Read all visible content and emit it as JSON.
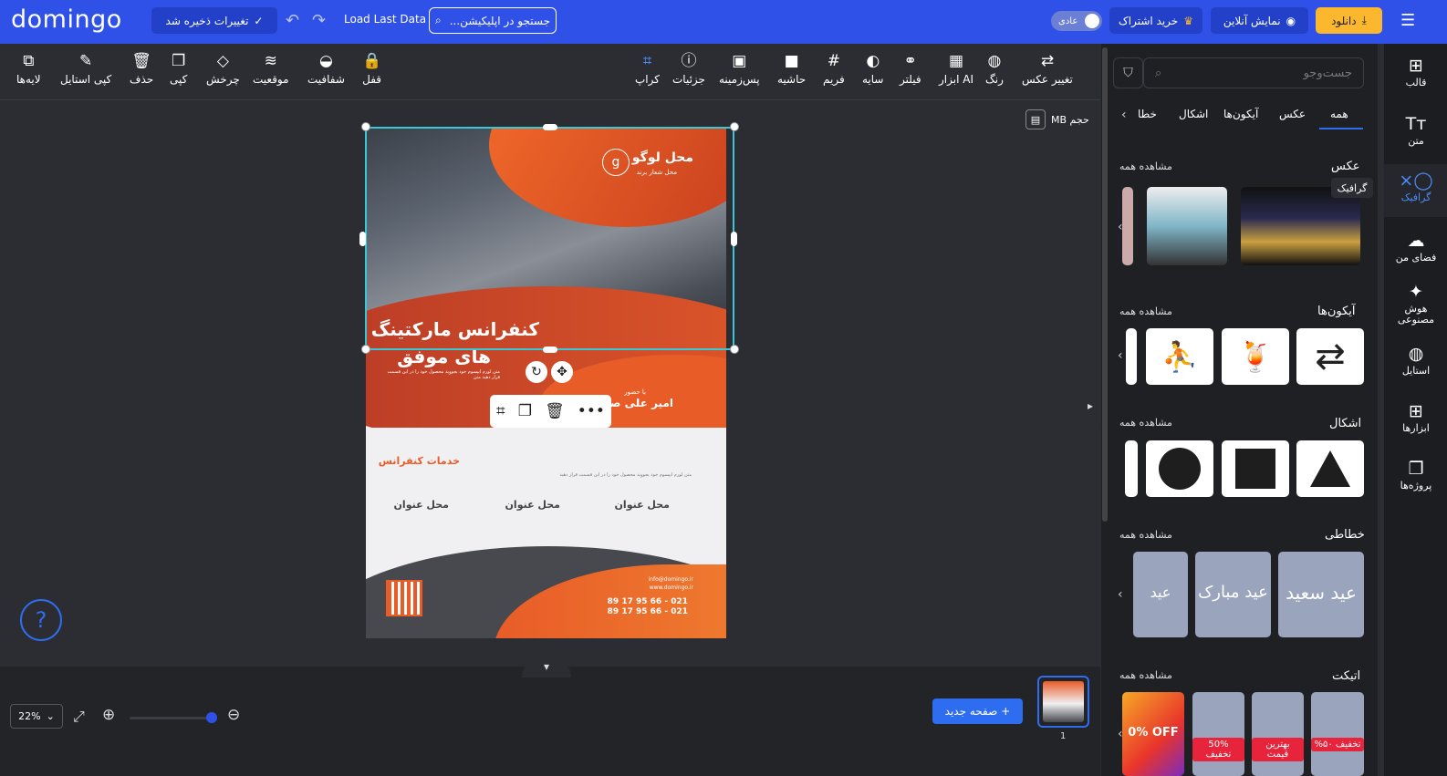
{
  "topbar": {
    "logo": "domingo",
    "save_label": "تغییرات ذخیره شد",
    "load_last": "Load Last Data",
    "search_placeholder": "جستجو در اپلیکیشن...",
    "mode_label": "عادی",
    "subscribe_label": "خرید اشتراک",
    "preview_label": "نمایش آنلاین",
    "download_label": "دانلود"
  },
  "toolbar": {
    "left": [
      {
        "label": "لایه‌ها",
        "icon": "layers-icon"
      },
      {
        "label": "کپی استایل",
        "icon": "brush-icon"
      },
      {
        "label": "حذف",
        "icon": "trash-icon"
      },
      {
        "label": "کپی",
        "icon": "copy-icon"
      },
      {
        "label": "چرخش",
        "icon": "rotate-icon"
      },
      {
        "label": "موقعیت",
        "icon": "position-icon"
      },
      {
        "label": "شفافیت",
        "icon": "opacity-icon"
      },
      {
        "label": "قفل",
        "icon": "lock-icon"
      }
    ],
    "right": [
      {
        "label": "کراپ",
        "icon": "crop-icon"
      },
      {
        "label": "جزئیات",
        "icon": "info-icon"
      },
      {
        "label": "پس‌زمینه",
        "icon": "background-icon"
      },
      {
        "label": "حاشیه",
        "icon": "border-icon"
      },
      {
        "label": "فریم",
        "icon": "frame-icon"
      },
      {
        "label": "سایه",
        "icon": "shadow-icon"
      },
      {
        "label": "فیلتر",
        "icon": "filter-icon"
      },
      {
        "label": "ابزار AI",
        "icon": "ai-icon"
      },
      {
        "label": "رنگ",
        "icon": "palette-icon"
      },
      {
        "label": "تغییر عکس",
        "icon": "replace-image-icon"
      }
    ]
  },
  "canvas": {
    "size_label": "حجم MB",
    "poster": {
      "logo_title": "محل لوگو",
      "logo_sub": "محل شعار برند",
      "title_line1": "کنفرانس مارکتینگ",
      "title_line2": "های موفق",
      "lorem1": "متن لورم ایپسوم خود بجووید محصول خود را در این قسمت قرار دهید متن",
      "presenter_small": "با حضور",
      "presenter": "امیر علی صادقی",
      "services": "خدمات کنفرانس",
      "service_text": "متن لورم ایپسوم خود بجووید محصول خود را در این قسمت قرار دهید",
      "address_label": "محل عنوان",
      "email": "info@domingo.ir",
      "web": "www.domingo.ir",
      "phone1": "021 - 66 95 17 89",
      "phone2": "021 - 66 95 17 89"
    }
  },
  "bottom": {
    "zoom": "22%",
    "new_page": "صفحه جدید",
    "page_number": "1"
  },
  "panel": {
    "search_placeholder": "جست‌وجو",
    "tabs": [
      "همه",
      "عکس",
      "آیکون‌ها",
      "اشکال",
      "خطا"
    ],
    "see_all": "مشاهده همه",
    "sections": {
      "photo": "عکس",
      "icons": "آیکون‌ها",
      "shapes": "اشکال",
      "calligraphy": "خطاطی",
      "label": "اتیکت"
    },
    "tooltip": "گرافیک",
    "calligraphy_texts": [
      "عید سعید",
      "عید مبارک",
      "عید مبارک"
    ],
    "label_texts": [
      "تخفیف ۵۰%",
      "بهترین قیمت",
      "50% تخفیف",
      "0% OFF"
    ]
  },
  "rail": [
    {
      "label": "قالب",
      "icon": "template-icon"
    },
    {
      "label": "متن",
      "icon": "text-icon"
    },
    {
      "label": "گرافیک",
      "icon": "graphics-icon"
    },
    {
      "label": "فضای من",
      "icon": "cloud-upload-icon"
    },
    {
      "label": "هوش مصنوعی",
      "icon": "magic-wand-icon"
    },
    {
      "label": "استایل",
      "icon": "palette-icon"
    },
    {
      "label": "ابزارها",
      "icon": "tools-icon"
    },
    {
      "label": "پروژه‌ها",
      "icon": "projects-icon"
    }
  ],
  "colors": {
    "brand": "#2f51e8",
    "accent": "#fbb82f",
    "selection": "#38c8d8",
    "poster_orange": "#e85c28"
  }
}
